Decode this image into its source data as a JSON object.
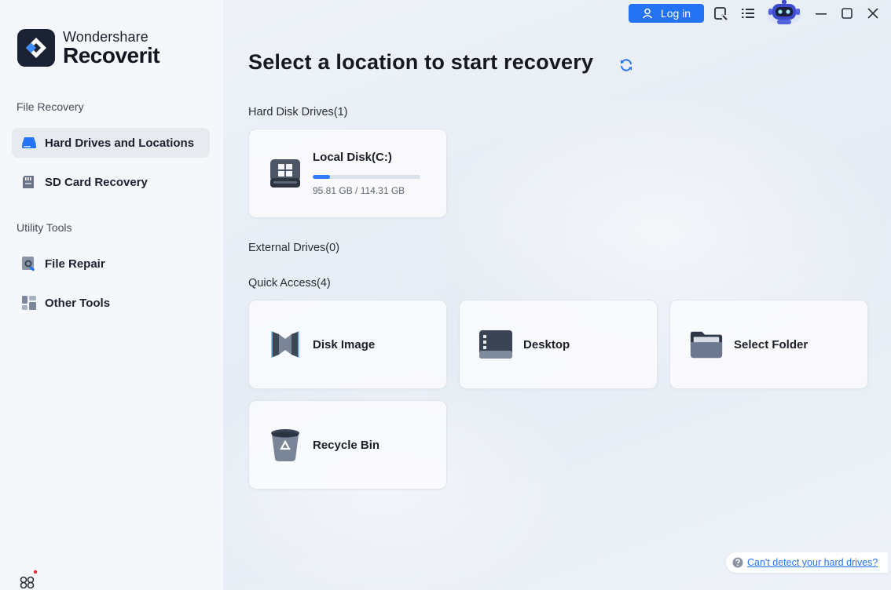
{
  "app": {
    "brand_top": "Wondershare",
    "brand_bottom": "Recoverit"
  },
  "sidebar": {
    "sections": [
      {
        "label": "File Recovery",
        "items": [
          {
            "label": "Hard Drives and Locations",
            "icon": "hard-drive-icon",
            "active": true
          },
          {
            "label": "SD Card Recovery",
            "icon": "sd-card-icon",
            "active": false
          }
        ]
      },
      {
        "label": "Utility Tools",
        "items": [
          {
            "label": "File Repair",
            "icon": "file-repair-icon",
            "active": false
          },
          {
            "label": "Other Tools",
            "icon": "other-tools-icon",
            "active": false
          }
        ]
      }
    ]
  },
  "topbar": {
    "login_label": "Log in"
  },
  "main": {
    "title": "Select a location to start recovery",
    "hard_disk_label": "Hard Disk Drives(1)",
    "disks": [
      {
        "name": "Local Disk(C:)",
        "size_text": "95.81 GB / 114.31 GB",
        "used_fraction": 0.16
      }
    ],
    "external_label": "External Drives(0)",
    "quick_access_label": "Quick Access(4)",
    "quick_access": [
      {
        "label": "Disk Image",
        "icon": "disk-image-icon"
      },
      {
        "label": "Desktop",
        "icon": "desktop-icon"
      },
      {
        "label": "Select Folder",
        "icon": "folder-icon"
      },
      {
        "label": "Recycle Bin",
        "icon": "recycle-bin-icon"
      }
    ]
  },
  "help": {
    "link_text": "Can't detect your hard drives?"
  },
  "colors": {
    "accent": "#2573f5",
    "sidebar_bg": "#f5f7fa",
    "main_bg": "#eef2f8"
  }
}
